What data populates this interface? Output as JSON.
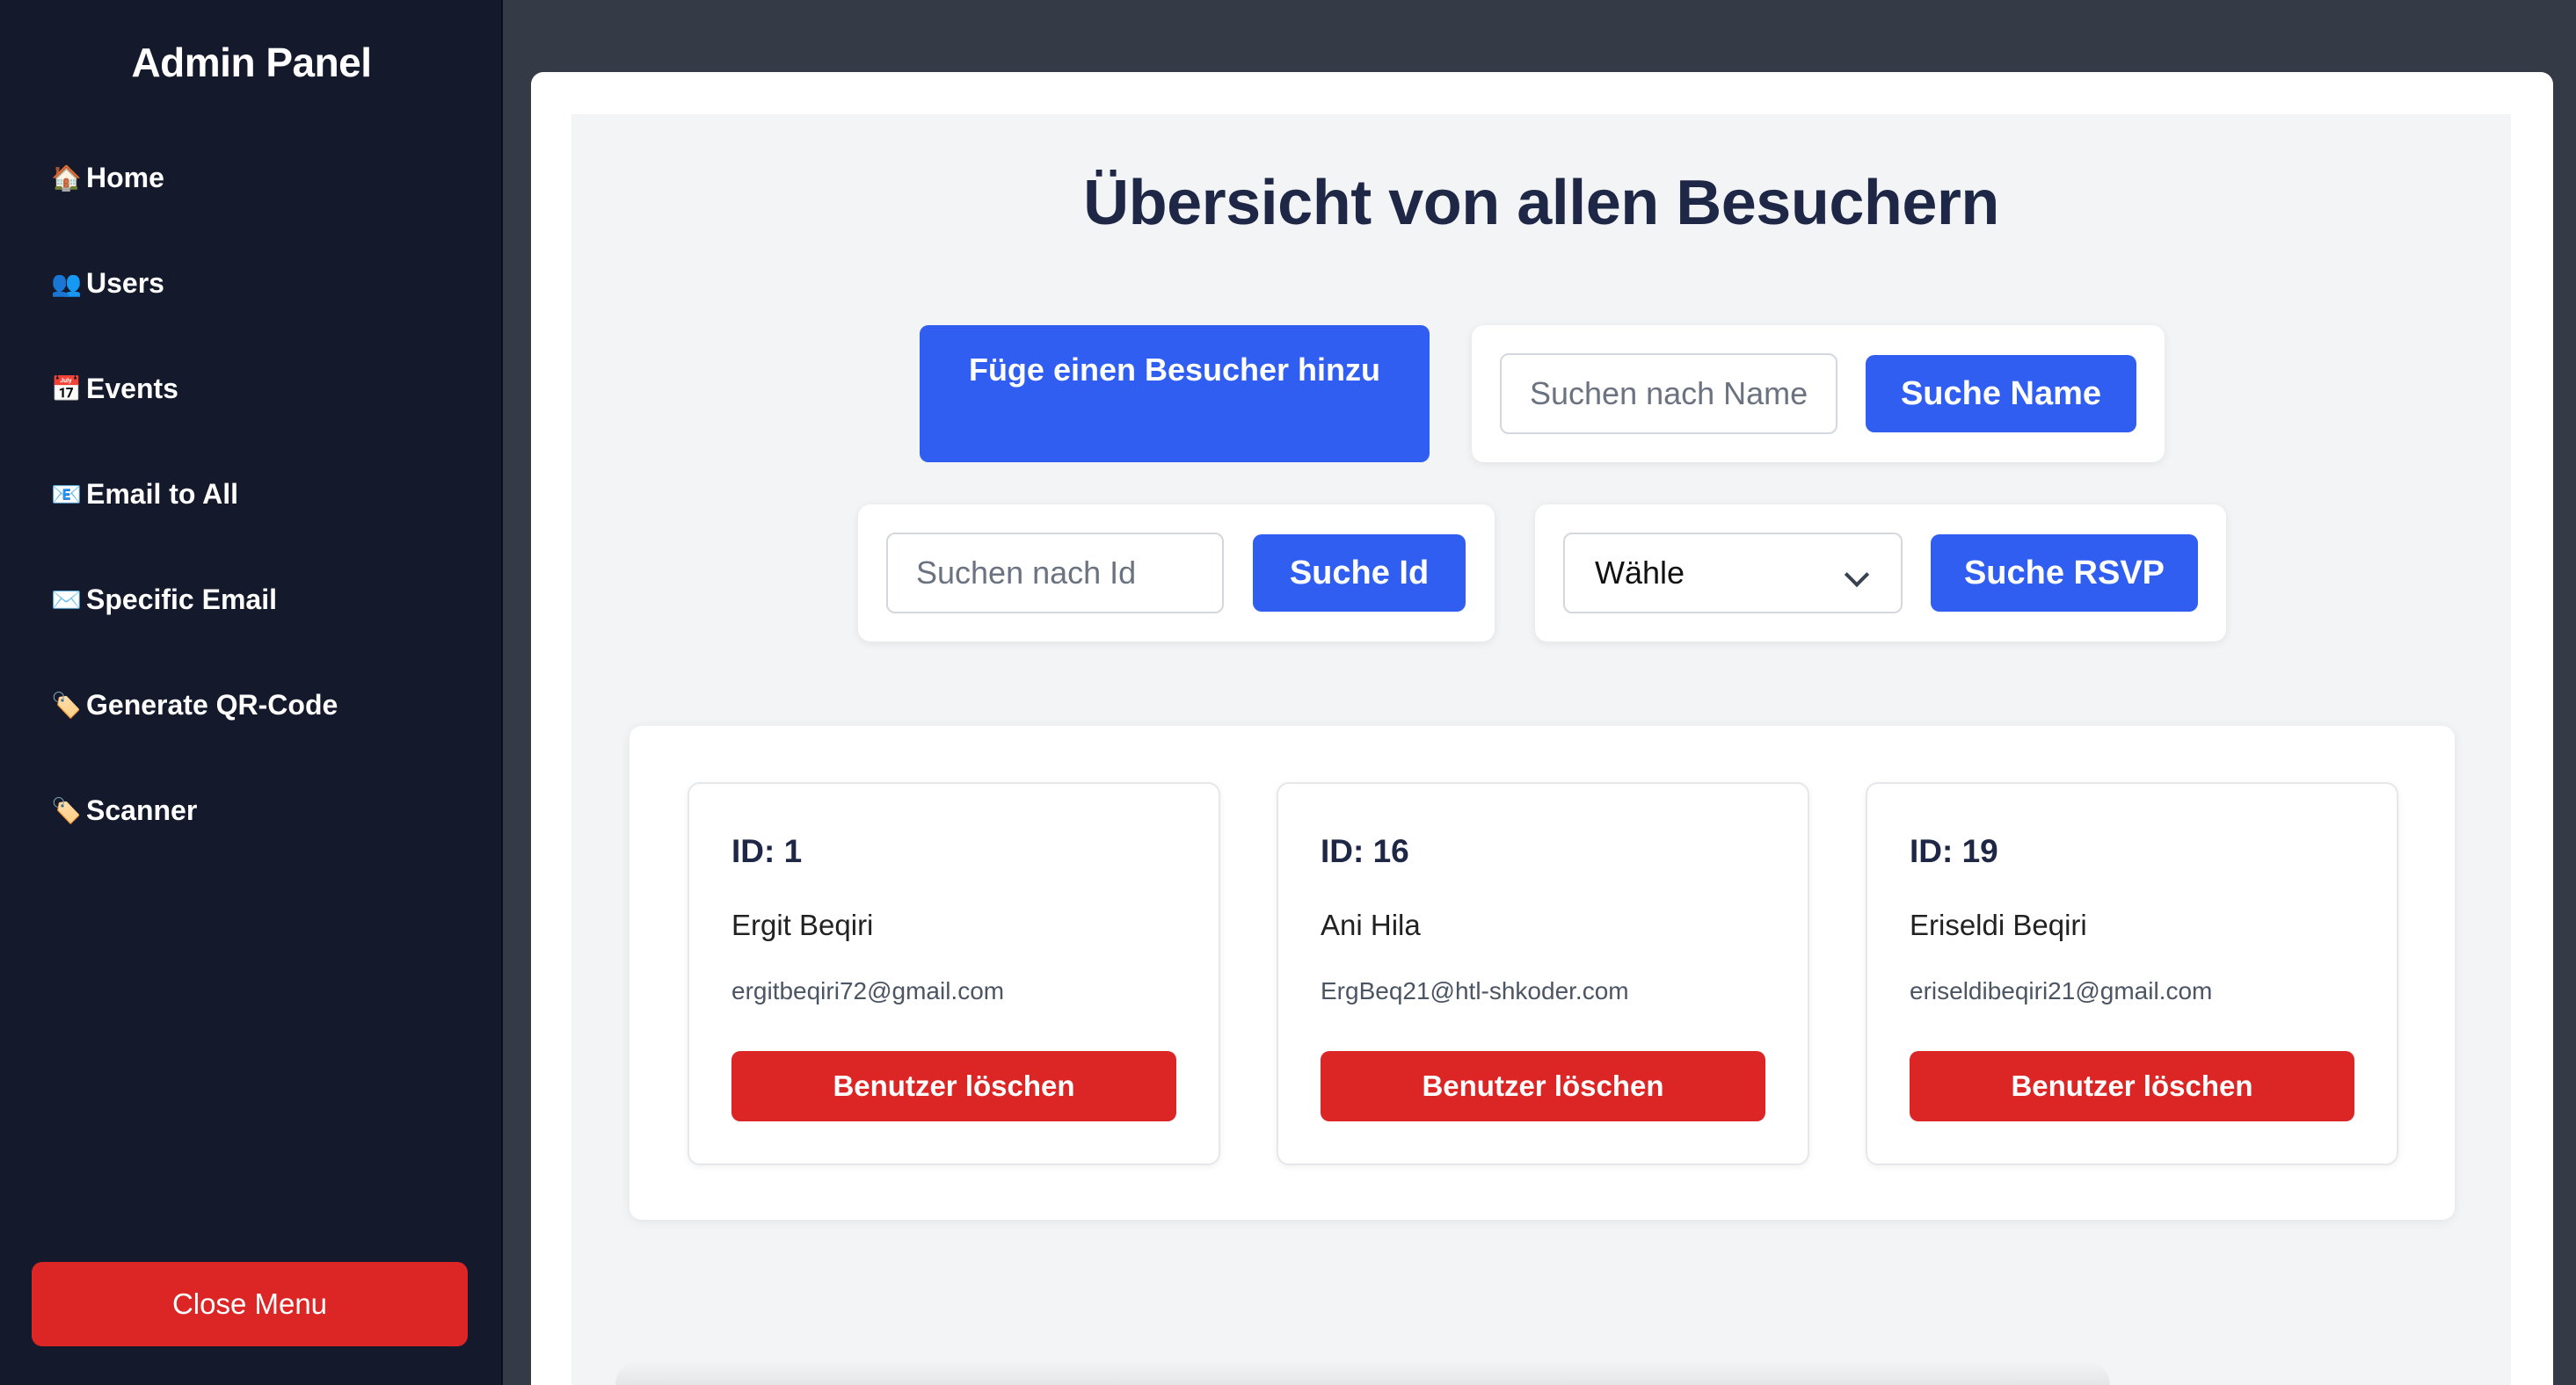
{
  "sidebar": {
    "title": "Admin Panel",
    "items": [
      {
        "icon": "🏠",
        "icon_name": "house-icon",
        "label": "Home"
      },
      {
        "icon": "👥",
        "icon_name": "users-icon",
        "label": "Users"
      },
      {
        "icon": "📅",
        "icon_name": "calendar-icon",
        "label": "Events"
      },
      {
        "icon": "📧",
        "icon_name": "email-icon",
        "label": "Email to All"
      },
      {
        "icon": "✉️",
        "icon_name": "envelope-icon",
        "label": "Specific Email"
      },
      {
        "icon": "🏷️",
        "icon_name": "ticket-icon",
        "label": "Generate QR-Code"
      },
      {
        "icon": "🏷️",
        "icon_name": "ticket-icon",
        "label": "Scanner"
      }
    ],
    "close_label": "Close Menu"
  },
  "main": {
    "title": "Übersicht von allen Besuchern",
    "add_visitor_label": "Füge einen Besucher hinzu",
    "search_name": {
      "placeholder": "Suchen nach Name",
      "button": "Suche Name"
    },
    "search_id": {
      "placeholder": "Suchen nach Id",
      "button": "Suche Id"
    },
    "search_rsvp": {
      "selected": "Wähle",
      "button": "Suche RSVP"
    }
  },
  "visitors": [
    {
      "id_label": "ID: 1",
      "name": "Ergit Beqiri",
      "email": "ergitbeqiri72@gmail.com",
      "delete_label": "Benutzer löschen"
    },
    {
      "id_label": "ID: 16",
      "name": "Ani Hila",
      "email": "ErgBeq21@htl-shkoder.com",
      "delete_label": "Benutzer löschen"
    },
    {
      "id_label": "ID: 19",
      "name": "Eriseldi Beqiri",
      "email": "eriseldibeqiri21@gmail.com",
      "delete_label": "Benutzer löschen"
    }
  ],
  "colors": {
    "sidebar_bg": "#141a2b",
    "primary_blue": "#2f5ef0",
    "danger_red": "#dc2626",
    "title_navy": "#1e2745"
  }
}
